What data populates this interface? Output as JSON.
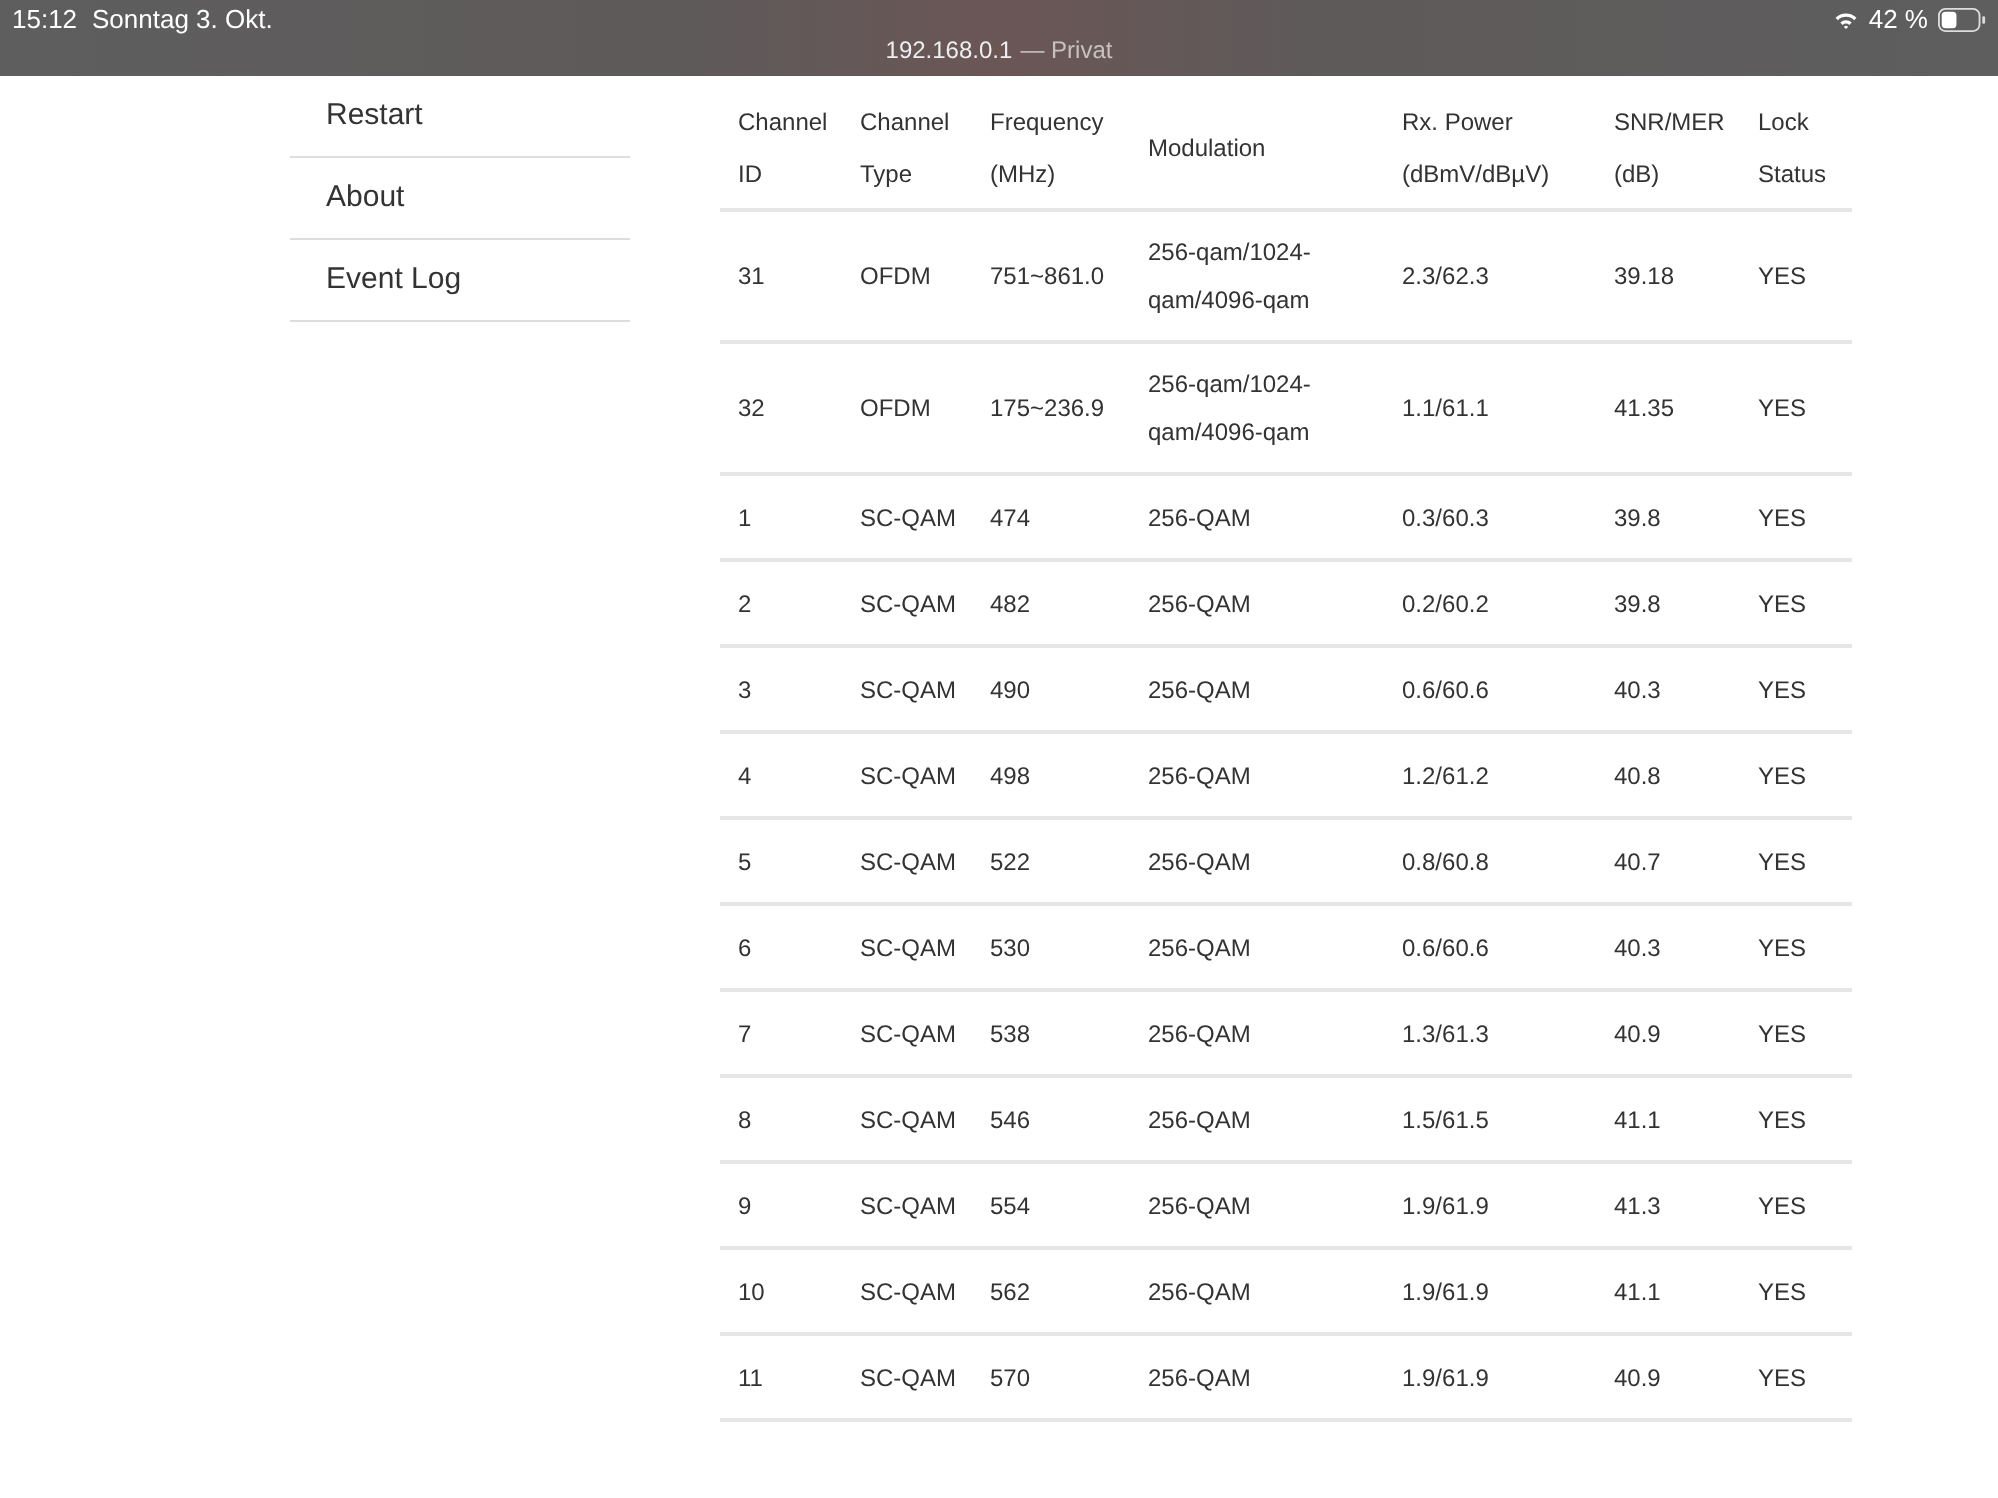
{
  "status_bar": {
    "time": "15:12",
    "date": "Sonntag 3. Okt.",
    "url": "192.168.0.1",
    "privacy": "— Privat",
    "battery": "42 %"
  },
  "sidebar": {
    "items": [
      {
        "label": "Restart"
      },
      {
        "label": "About"
      },
      {
        "label": "Event Log"
      }
    ]
  },
  "table": {
    "columns": [
      "Channel\nID",
      "Channel\nType",
      "Frequency\n(MHz)",
      "Modulation",
      "Rx. Power\n(dBmV/dBµV)",
      "SNR/MER\n(dB)",
      "Lock\nStatus"
    ],
    "rows": [
      [
        "31",
        "OFDM",
        "751~861.0",
        "256-qam/1024-\nqam/4096-qam",
        "2.3/62.3",
        "39.18",
        "YES"
      ],
      [
        "32",
        "OFDM",
        "175~236.9",
        "256-qam/1024-\nqam/4096-qam",
        "1.1/61.1",
        "41.35",
        "YES"
      ],
      [
        "1",
        "SC-QAM",
        "474",
        "256-QAM",
        "0.3/60.3",
        "39.8",
        "YES"
      ],
      [
        "2",
        "SC-QAM",
        "482",
        "256-QAM",
        "0.2/60.2",
        "39.8",
        "YES"
      ],
      [
        "3",
        "SC-QAM",
        "490",
        "256-QAM",
        "0.6/60.6",
        "40.3",
        "YES"
      ],
      [
        "4",
        "SC-QAM",
        "498",
        "256-QAM",
        "1.2/61.2",
        "40.8",
        "YES"
      ],
      [
        "5",
        "SC-QAM",
        "522",
        "256-QAM",
        "0.8/60.8",
        "40.7",
        "YES"
      ],
      [
        "6",
        "SC-QAM",
        "530",
        "256-QAM",
        "0.6/60.6",
        "40.3",
        "YES"
      ],
      [
        "7",
        "SC-QAM",
        "538",
        "256-QAM",
        "1.3/61.3",
        "40.9",
        "YES"
      ],
      [
        "8",
        "SC-QAM",
        "546",
        "256-QAM",
        "1.5/61.5",
        "41.1",
        "YES"
      ],
      [
        "9",
        "SC-QAM",
        "554",
        "256-QAM",
        "1.9/61.9",
        "41.3",
        "YES"
      ],
      [
        "10",
        "SC-QAM",
        "562",
        "256-QAM",
        "1.9/61.9",
        "41.1",
        "YES"
      ],
      [
        "11",
        "SC-QAM",
        "570",
        "256-QAM",
        "1.9/61.9",
        "40.9",
        "YES"
      ]
    ]
  }
}
